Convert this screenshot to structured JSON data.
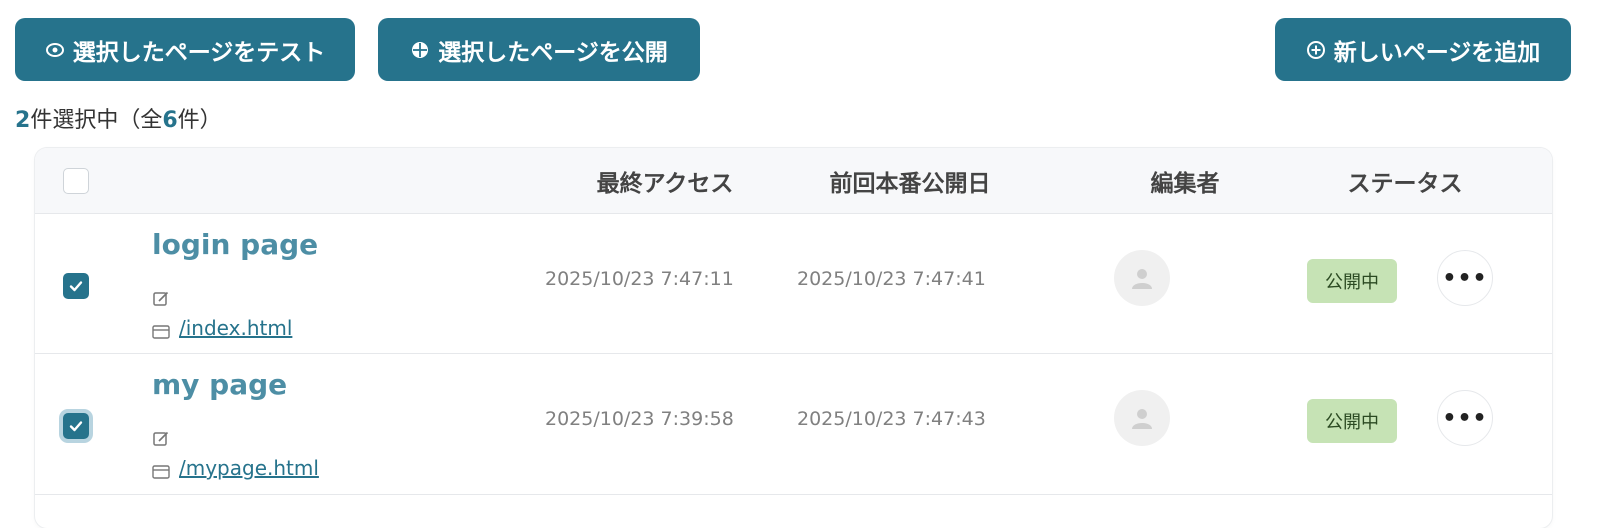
{
  "toolbar": {
    "test_label": "選択したページをテスト",
    "publish_label": "選択したページを公開",
    "add_label": "新しいページを追加"
  },
  "selection": {
    "count": "2",
    "text_a": "件選択中（全",
    "total": "6",
    "text_b": "件）"
  },
  "table": {
    "headers": {
      "last_access": "最終アクセス",
      "prev_publish": "前回本番公開日",
      "editor": "編集者",
      "status": "ステータス"
    },
    "rows": [
      {
        "name": "login page",
        "path": "/index.html",
        "last_access": "2025/10/23 7:47:11",
        "prev_publish": "2025/10/23 7:47:41",
        "status": "公開中",
        "more": "•••",
        "checked": true
      },
      {
        "name": "my page",
        "path": "/mypage.html",
        "last_access": "2025/10/23 7:39:58",
        "prev_publish": "2025/10/23 7:47:43",
        "status": "公開中",
        "more": "•••",
        "checked": true
      }
    ]
  },
  "colors": {
    "accent": "#26738c",
    "status_badge": "#c6e3b5"
  },
  "icons": [
    "eye-icon",
    "globe-icon",
    "plus-circle-icon",
    "edit-icon",
    "file-icon",
    "user-icon",
    "check-icon",
    "more-icon"
  ]
}
